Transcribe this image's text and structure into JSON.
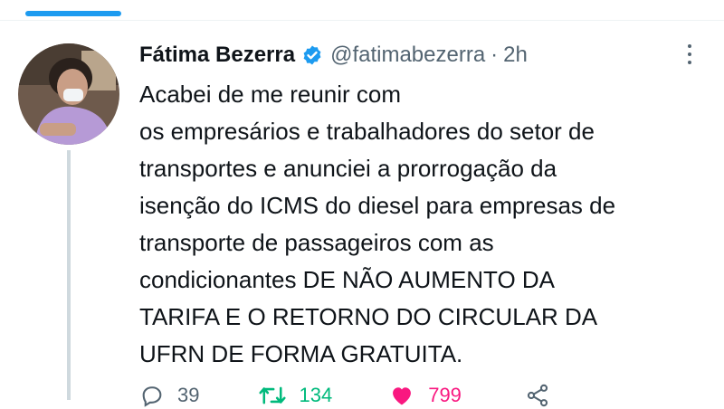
{
  "tweet": {
    "author_name": "Fátima Bezerra",
    "handle": "@fatimabezerra",
    "separator": "·",
    "time": "2h",
    "text_lines": [
      "Acabei de me reunir com",
      "os empresários e  trabalhadores do setor de",
      "transportes e anunciei a prorrogação da",
      "isenção do ICMS do diesel para empresas de",
      "transporte de passageiros com as",
      "condicionantes DE NÃO AUMENTO DA",
      "TARIFA E O RETORNO DO CIRCULAR DA",
      "UFRN DE FORMA GRATUITA."
    ]
  },
  "actions": {
    "reply_count": "39",
    "retweet_count": "134",
    "like_count": "799"
  },
  "icons": {
    "verified": "verified-badge-icon",
    "more": "more-options-icon",
    "reply": "reply-icon",
    "retweet": "retweet-icon",
    "like": "like-icon",
    "share": "share-icon"
  },
  "colors": {
    "accent": "#1d9bf0",
    "text": "#0f1419",
    "secondary": "#536471",
    "retweet_active": "#00ba7c",
    "like_active": "#f91880",
    "thread_line": "#cfd9de"
  }
}
